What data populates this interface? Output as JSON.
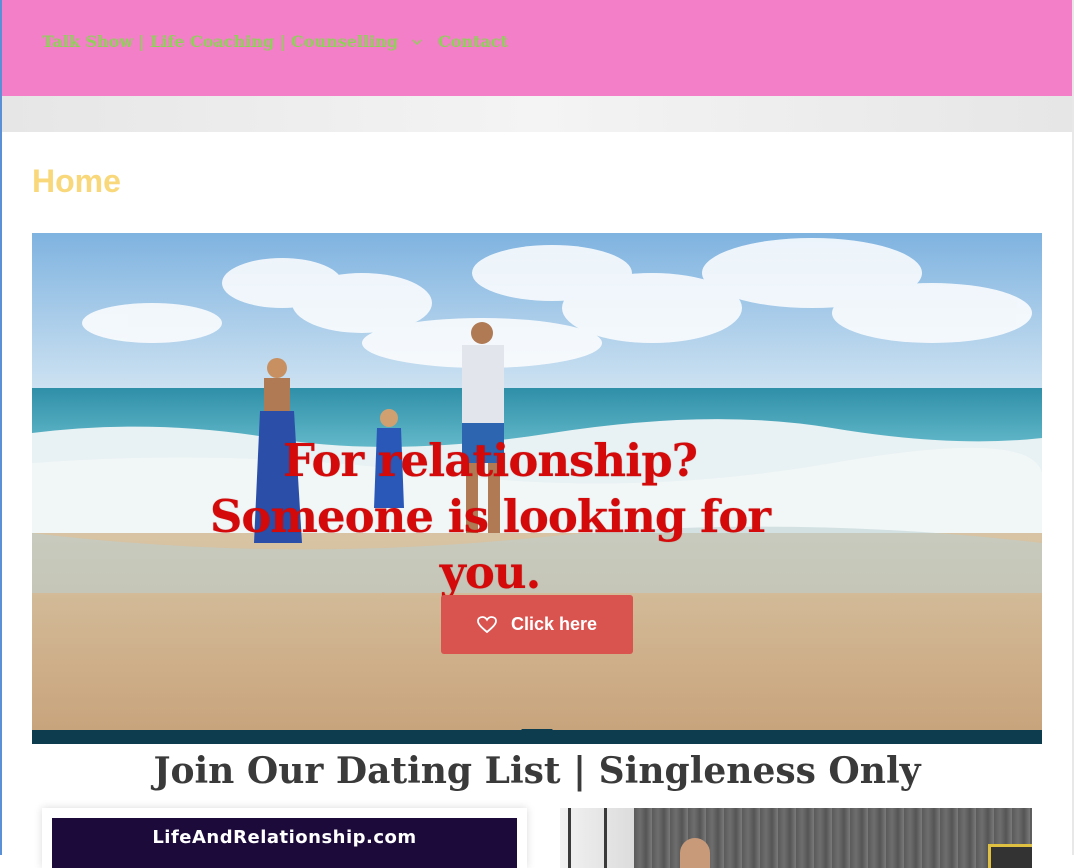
{
  "nav": {
    "items": [
      {
        "label": "Talk Show | Life Coaching | Counselling",
        "has_dropdown": true
      },
      {
        "label": "Contact",
        "has_dropdown": false
      }
    ],
    "dropdown_icon": "chevron-down-icon"
  },
  "page": {
    "title": "Home"
  },
  "hero": {
    "headline": "For relationship? Someone is looking for you.",
    "button_label": "Click here",
    "button_icon": "heart-icon"
  },
  "section": {
    "heading": "Join Our Dating List | Singleness Only"
  },
  "cards": {
    "left_banner_text": "LifeAndRelationship.com"
  },
  "colors": {
    "topbar": "#f47fc9",
    "nav_text": "#8fcf5a",
    "title": "#f8d87a",
    "headline": "#d40a0a",
    "button": "#d9534f",
    "strip": "#0d3c4e"
  }
}
